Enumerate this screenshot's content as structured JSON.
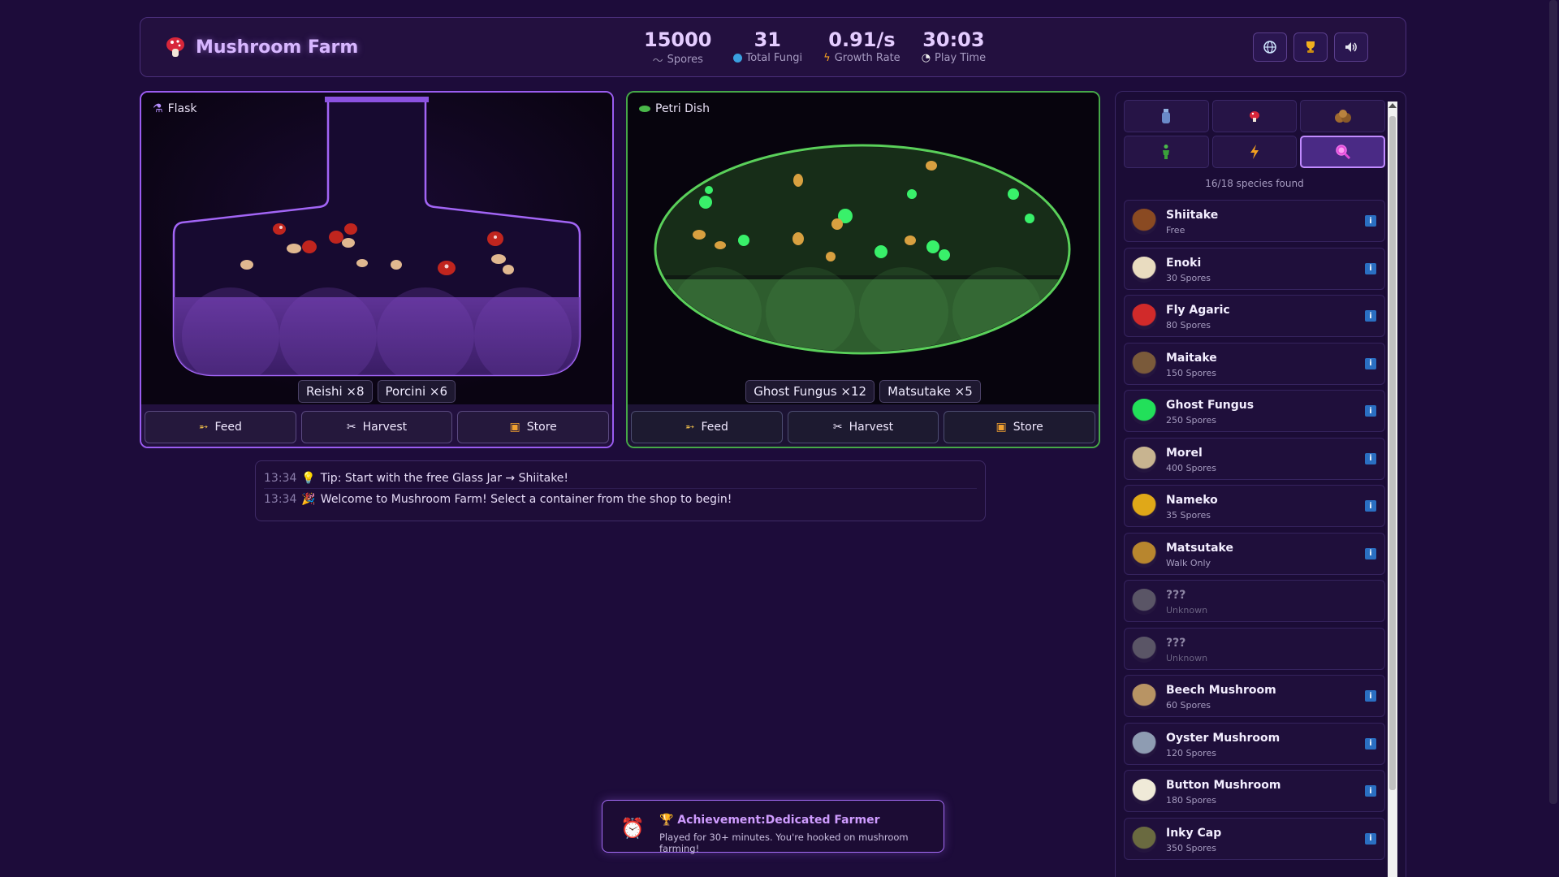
{
  "header": {
    "title": "Mushroom Farm",
    "stats": [
      {
        "value": "15000",
        "label": "Spores",
        "icon": "spore-icon"
      },
      {
        "value": "31",
        "label": "Total Fungi",
        "icon": "globe-icon"
      },
      {
        "value": "0.91/s",
        "label": "Growth Rate",
        "icon": "bolt-icon"
      },
      {
        "value": "30:03",
        "label": "Play Time",
        "icon": "stopwatch-icon"
      }
    ],
    "buttons": [
      "globe-icon",
      "trophy-icon",
      "speaker-icon"
    ]
  },
  "containers": [
    {
      "name": "Flask",
      "tags": [
        "Reishi ×8",
        "Porcini ×6"
      ],
      "actions": {
        "feed": "Feed",
        "harvest": "Harvest",
        "store": "Store"
      }
    },
    {
      "name": "Petri Dish",
      "tags": [
        "Ghost Fungus ×12",
        "Matsutake ×5"
      ],
      "actions": {
        "feed": "Feed",
        "harvest": "Harvest",
        "store": "Store"
      }
    }
  ],
  "log": [
    {
      "time": "13:34",
      "icon": "💡",
      "text": "Tip: Start with the free Glass Jar → Shiitake!"
    },
    {
      "time": "13:34",
      "icon": "🎉",
      "text": "Welcome to Mushroom Farm! Select a container from the shop to begin!"
    }
  ],
  "sidebar": {
    "tabs": [
      "bottle-icon",
      "mushroom-icon",
      "cookie-icon",
      "person-icon",
      "bolt-icon",
      "search-icon"
    ],
    "species_found": "16/18 species found",
    "species": [
      {
        "name": "Shiitake",
        "sub": "Free",
        "color": "#8a4a22",
        "known": true
      },
      {
        "name": "Enoki",
        "sub": "30 Spores",
        "color": "#e9dcc0",
        "known": true
      },
      {
        "name": "Fly Agaric",
        "sub": "80 Spores",
        "color": "#d12a2a",
        "known": true
      },
      {
        "name": "Maitake",
        "sub": "150 Spores",
        "color": "#7a5a3a",
        "known": true
      },
      {
        "name": "Ghost Fungus",
        "sub": "250 Spores",
        "color": "#22e05a",
        "known": true
      },
      {
        "name": "Morel",
        "sub": "400 Spores",
        "color": "#c8b490",
        "known": true
      },
      {
        "name": "Nameko",
        "sub": "35 Spores",
        "color": "#e0a818",
        "known": true
      },
      {
        "name": "Matsutake",
        "sub": "Walk Only",
        "color": "#b8862e",
        "known": true
      },
      {
        "name": "???",
        "sub": "Unknown",
        "color": "#5a5566",
        "known": false
      },
      {
        "name": "???",
        "sub": "Unknown",
        "color": "#5a5566",
        "known": false
      },
      {
        "name": "Beech Mushroom",
        "sub": "60 Spores",
        "color": "#b89464",
        "known": true
      },
      {
        "name": "Oyster Mushroom",
        "sub": "120 Spores",
        "color": "#8e9cb2",
        "known": true
      },
      {
        "name": "Button Mushroom",
        "sub": "180 Spores",
        "color": "#f0ead8",
        "known": true
      },
      {
        "name": "Inky Cap",
        "sub": "350 Spores",
        "color": "#6a6a40",
        "known": true
      }
    ]
  },
  "toast": {
    "icon": "⏰",
    "title": "🏆 Achievement:Dedicated Farmer",
    "description": "Played for 30+ minutes. You're hooked on mushroom farming!"
  }
}
